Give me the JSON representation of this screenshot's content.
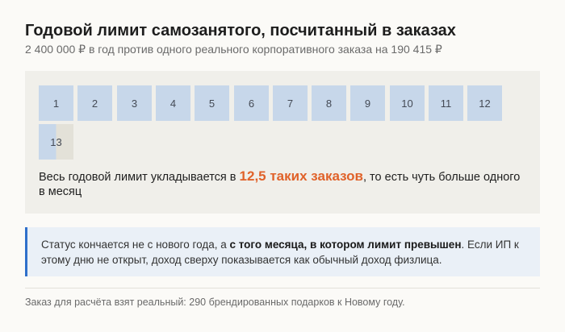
{
  "header": {
    "title": "Годовой лимит самозанятого, посчитанный в заказах",
    "subtitle": "2 400 000 ₽ в год против одного реального корпоративного заказа на 190 415 ₽"
  },
  "orders": {
    "cells": [
      {
        "label": "1",
        "fill": 1
      },
      {
        "label": "2",
        "fill": 1
      },
      {
        "label": "3",
        "fill": 1
      },
      {
        "label": "4",
        "fill": 1
      },
      {
        "label": "5",
        "fill": 1
      },
      {
        "label": "6",
        "fill": 1
      },
      {
        "label": "7",
        "fill": 1
      },
      {
        "label": "8",
        "fill": 1
      },
      {
        "label": "9",
        "fill": 1
      },
      {
        "label": "10",
        "fill": 1
      },
      {
        "label": "11",
        "fill": 1
      },
      {
        "label": "12",
        "fill": 1
      },
      {
        "label": "13",
        "fill": 0.5
      }
    ],
    "result_before": "Весь годовой лимит укладывается в ",
    "result_accent": "12,5 таких заказов",
    "result_after": ", то есть чуть больше одного в месяц"
  },
  "note": {
    "text_before": "Статус кончается не с нового года, а ",
    "text_bold": "с того месяца, в котором лимит превышен",
    "text_after": ". Если ИП к этому дню не открыт, доход сверху показывается как обычный доход физлица."
  },
  "footnote": "Заказ для расчёта взят реальный: 290 брендированных подарков к Новому году.",
  "colors": {
    "accent": "#e0622a",
    "cell_fill": "#c7d7ea",
    "note_border": "#2f6fca"
  }
}
